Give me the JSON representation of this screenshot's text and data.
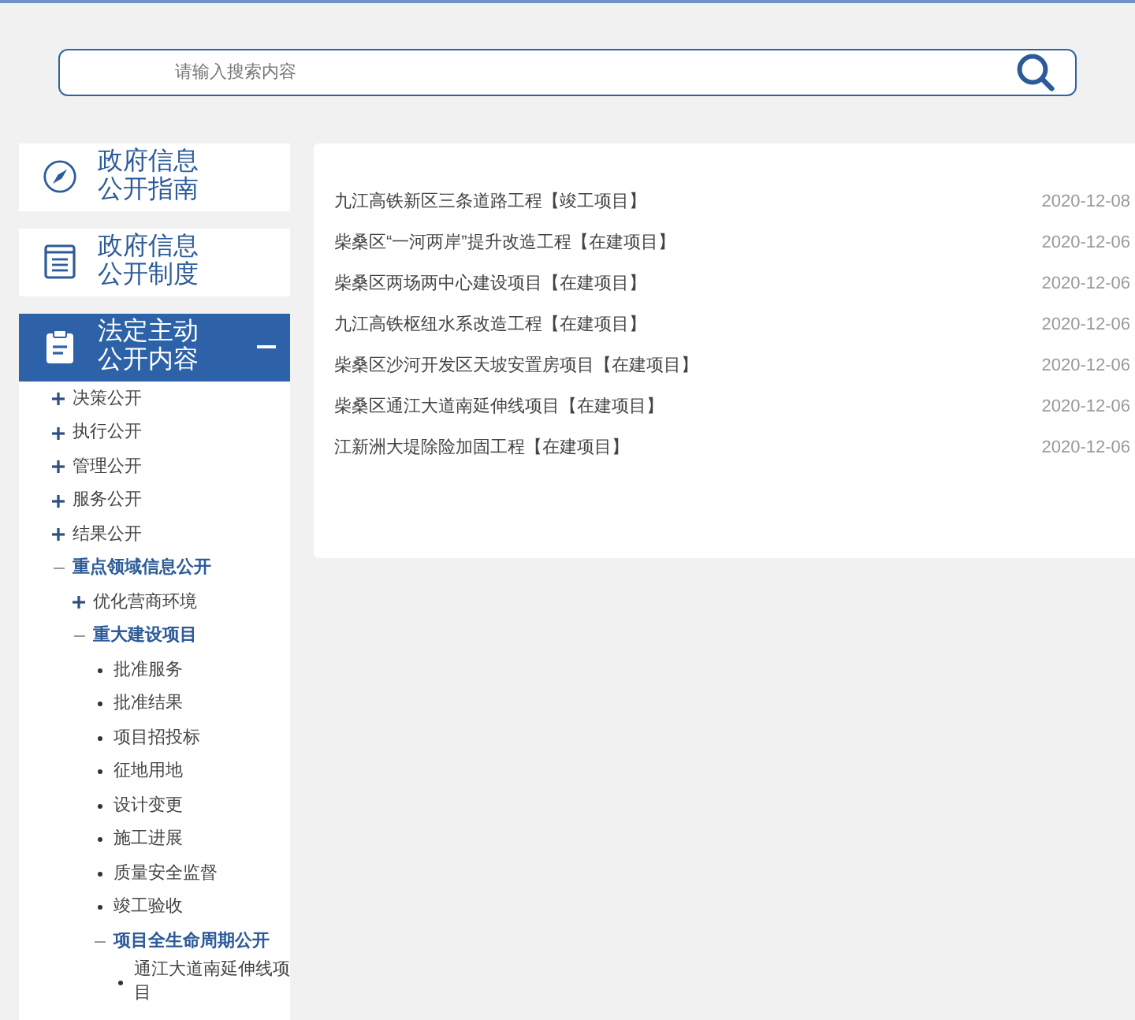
{
  "search": {
    "placeholder": "请输入搜索内容"
  },
  "sidebar": {
    "sections": [
      {
        "title": "政府信息公开指南",
        "kind": "link",
        "selected": false
      },
      {
        "title": "政府信息公开制度",
        "kind": "link",
        "selected": false
      },
      {
        "title": "法定主动公开内容",
        "kind": "group",
        "selected": true,
        "expanded": true,
        "children": [
          {
            "label": "决策公开",
            "kind": "branch",
            "expanded": false
          },
          {
            "label": "执行公开",
            "kind": "branch",
            "expanded": false
          },
          {
            "label": "管理公开",
            "kind": "branch",
            "expanded": false
          },
          {
            "label": "服务公开",
            "kind": "branch",
            "expanded": false
          },
          {
            "label": "结果公开",
            "kind": "branch",
            "expanded": false
          },
          {
            "label": "重点领域信息公开",
            "kind": "branch",
            "expanded": true,
            "children": [
              {
                "label": "优化营商环境",
                "kind": "branch",
                "expanded": false
              },
              {
                "label": "重大建设项目",
                "kind": "branch",
                "expanded": true,
                "children": [
                  {
                    "label": "批准服务",
                    "kind": "leaf"
                  },
                  {
                    "label": "批准结果",
                    "kind": "leaf"
                  },
                  {
                    "label": "项目招投标",
                    "kind": "leaf"
                  },
                  {
                    "label": "征地用地",
                    "kind": "leaf"
                  },
                  {
                    "label": "设计变更",
                    "kind": "leaf"
                  },
                  {
                    "label": "施工进展",
                    "kind": "leaf"
                  },
                  {
                    "label": "质量安全监督",
                    "kind": "leaf"
                  },
                  {
                    "label": "竣工验收",
                    "kind": "leaf"
                  },
                  {
                    "label": "项目全生命周期公开",
                    "kind": "branch",
                    "expanded": true,
                    "children": [
                      {
                        "label": "通江大道南延伸线项目",
                        "kind": "leaf"
                      }
                    ]
                  }
                ]
              }
            ]
          }
        ]
      }
    ]
  },
  "news_list": {
    "items": [
      {
        "title": "九江高铁新区三条道路工程【竣工项目】",
        "date": "2020-12-08"
      },
      {
        "title": "柴桑区“一河两岸”提升改造工程【在建项目】",
        "date": "2020-12-06"
      },
      {
        "title": "柴桑区两场两中心建设项目【在建项目】",
        "date": "2020-12-06"
      },
      {
        "title": "九江高铁枢纽水系改造工程【在建项目】",
        "date": "2020-12-06"
      },
      {
        "title": "柴桑区沙河开发区天坡安置房项目【在建项目】",
        "date": "2020-12-06"
      },
      {
        "title": "柴桑区通江大道南延伸线项目【在建项目】",
        "date": "2020-12-06"
      },
      {
        "title": "江新洲大堤除险加固工程【在建项目】",
        "date": "2020-12-06"
      }
    ]
  }
}
